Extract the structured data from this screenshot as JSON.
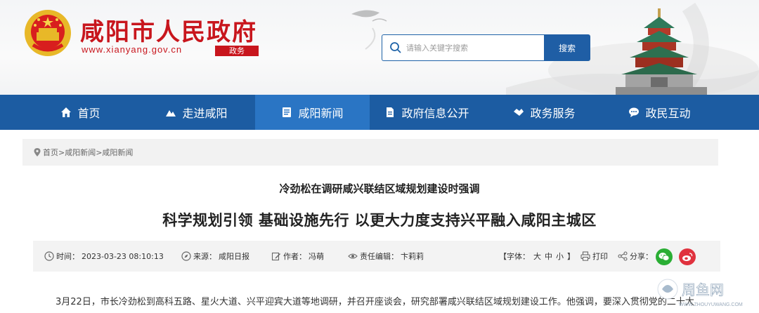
{
  "header": {
    "site_title": "咸阳市人民政府",
    "site_url": "www.xianyang.gov.cn",
    "site_tag": "政务",
    "search_placeholder": "请输入关键字搜索",
    "search_button": "搜索"
  },
  "nav": {
    "items": [
      {
        "label": "首页",
        "icon": "home-icon"
      },
      {
        "label": "走进咸阳",
        "icon": "mountain-icon"
      },
      {
        "label": "咸阳新闻",
        "icon": "news-icon",
        "active": true
      },
      {
        "label": "政府信息公开",
        "icon": "document-icon"
      },
      {
        "label": "政务服务",
        "icon": "handshake-icon"
      },
      {
        "label": "政民互动",
        "icon": "chat-icon"
      }
    ]
  },
  "breadcrumb": "首页>咸阳新闻>咸阳新闻",
  "article": {
    "subtitle": "冷劲松在调研咸兴联结区域规划建设时强调",
    "title": "科学规划引领 基础设施先行 以更大力度支持兴平融入咸阳主城区",
    "time_label": "时间：",
    "time": "2023-03-23 08:10:13",
    "source_label": "来源：",
    "source": "咸阳日报",
    "author_label": "作者：",
    "author": "冯萌",
    "editor_label": "责任编辑：",
    "editor": "卞莉莉",
    "font_label": "【字体：",
    "font_large": "大",
    "font_medium": "中",
    "font_small": "小",
    "font_end": "】",
    "print": "打印",
    "share": "分享：",
    "body_first_line": "3月22日，市长冷劲松到高科五路、星火大道、兴平迎宾大道等地调研，并召开座谈会，研究部署咸兴联结区域规划建设工作。他强调，要深入贯彻党的二十大"
  },
  "watermark": {
    "text": "周鱼网",
    "url": "WWW.ZHOUYUWANG.COM"
  },
  "colors": {
    "brand_red": "#c8161d",
    "nav_blue": "#1c5ca2",
    "nav_active": "#2a75c4",
    "wechat_green": "#2aae34",
    "weibo_red": "#e0323e"
  }
}
